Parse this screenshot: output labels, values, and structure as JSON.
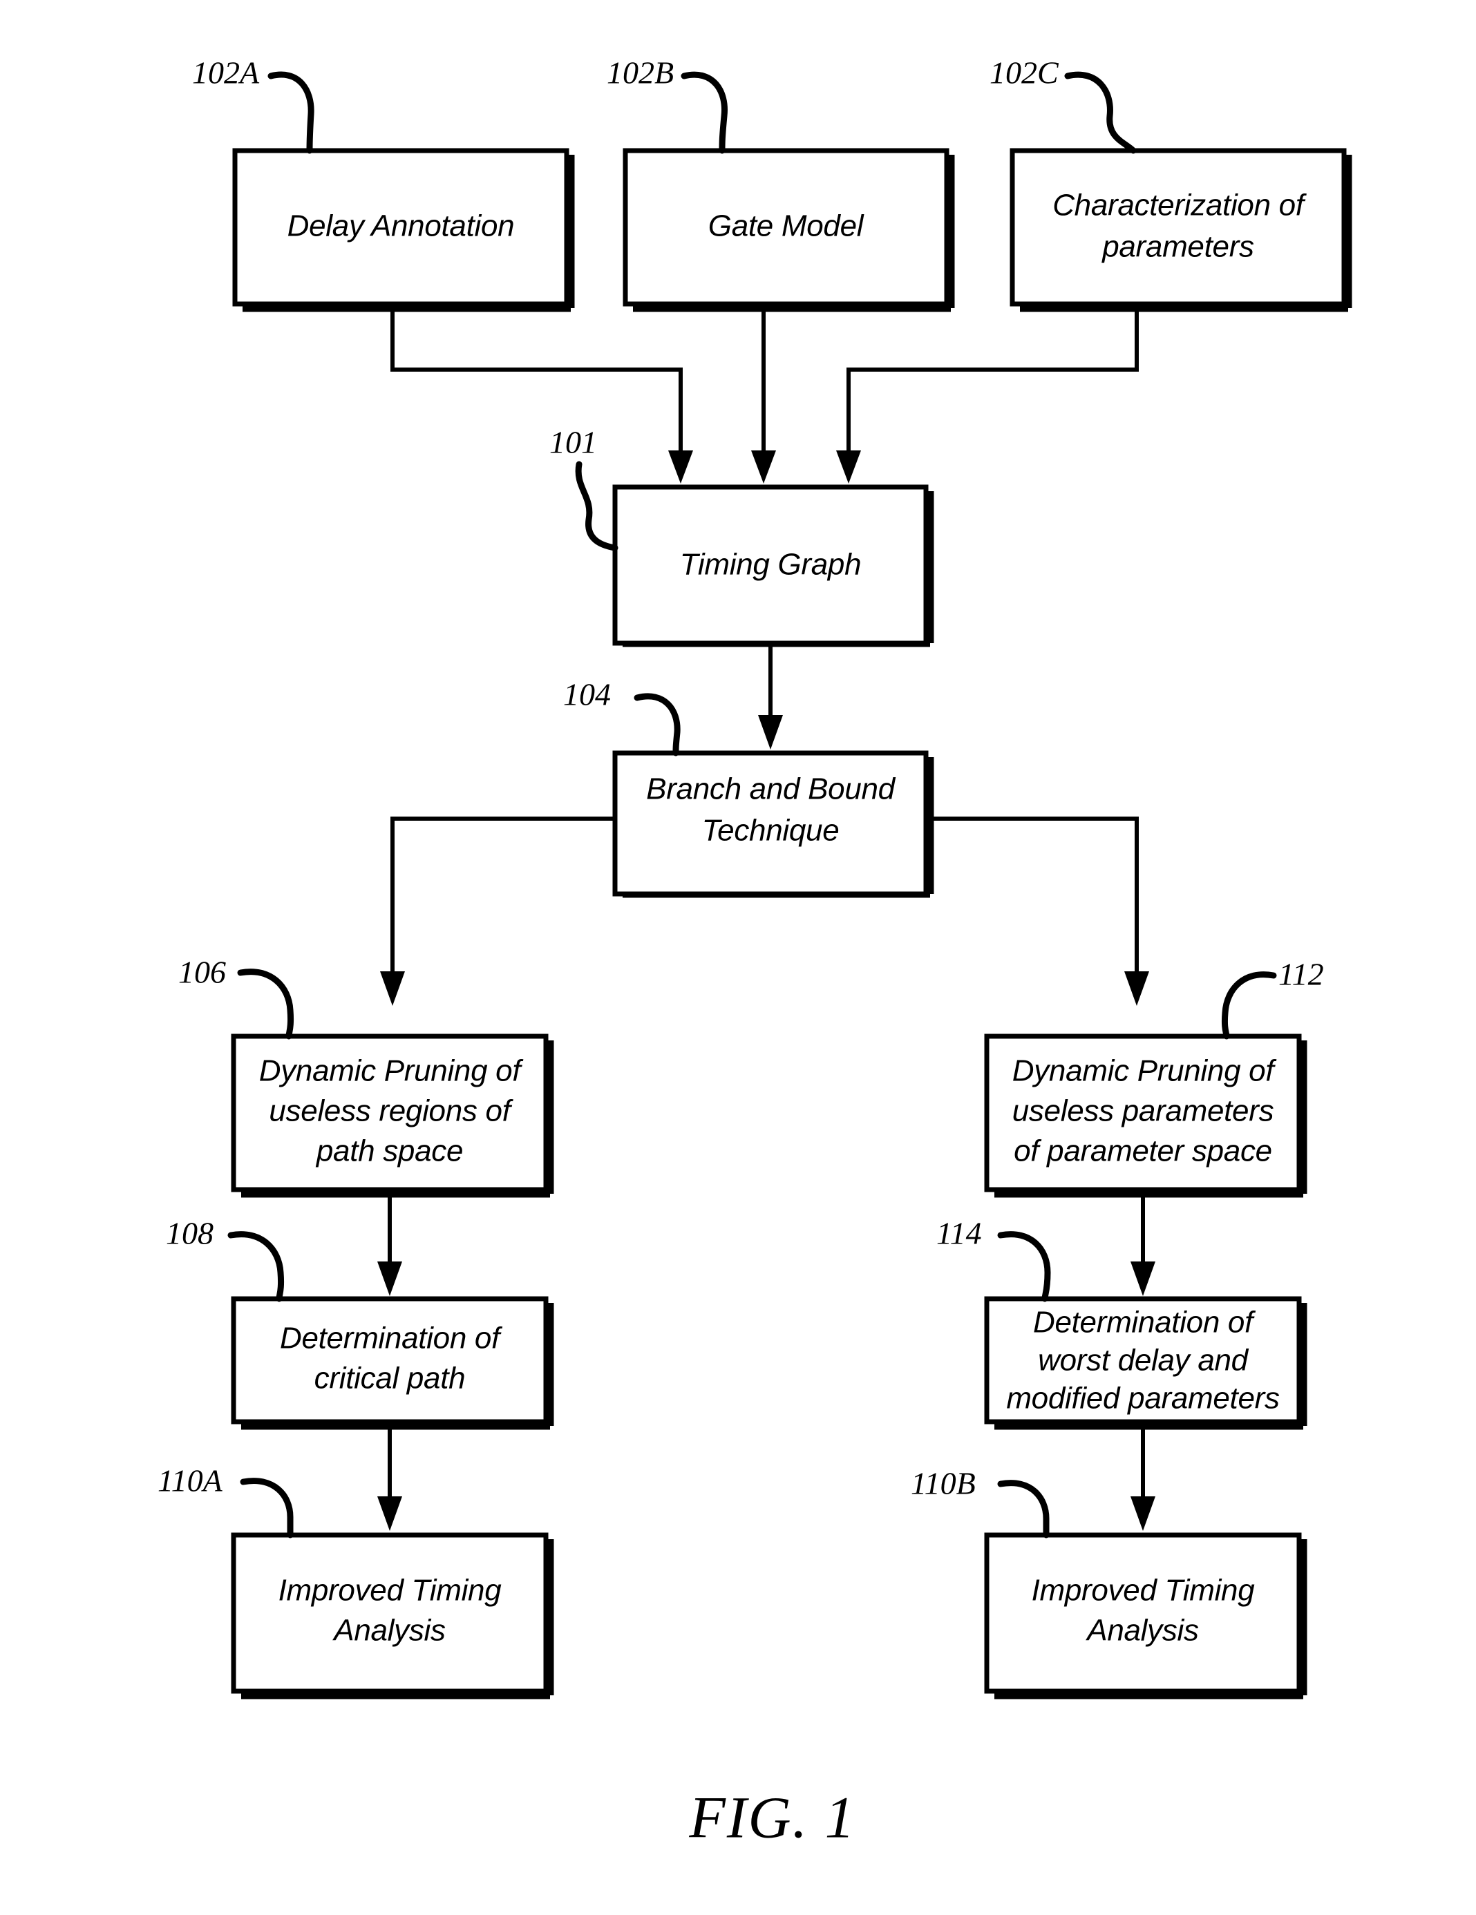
{
  "figure": {
    "caption": "FIG. 1",
    "background_color": "#ffffff",
    "line_color": "#000000"
  },
  "nodes": {
    "delay_annotation": {
      "ref": "102A",
      "lines": [
        "Delay Annotation"
      ]
    },
    "gate_model": {
      "ref": "102B",
      "lines": [
        "Gate Model"
      ]
    },
    "characterization": {
      "ref": "102C",
      "lines": [
        "Characterization of",
        "parameters"
      ]
    },
    "timing_graph": {
      "ref": "101",
      "lines": [
        "Timing Graph"
      ]
    },
    "branch_and_bound": {
      "ref": "104",
      "lines": [
        "Branch and Bound",
        "Technique"
      ]
    },
    "dynamic_pruning_paths": {
      "ref": "106",
      "lines": [
        "Dynamic Pruning of",
        "useless regions of",
        "path space"
      ]
    },
    "determination_critical_path": {
      "ref": "108",
      "lines": [
        "Determination of",
        "critical path"
      ]
    },
    "improved_timing_left": {
      "ref": "110A",
      "lines": [
        "Improved Timing",
        "Analysis"
      ]
    },
    "dynamic_pruning_params": {
      "ref": "112",
      "lines": [
        "Dynamic Pruning of",
        "useless parameters",
        "of parameter space"
      ]
    },
    "determination_worst_delay": {
      "ref": "114",
      "lines": [
        "Determination of",
        "worst delay and",
        "modified parameters"
      ]
    },
    "improved_timing_right": {
      "ref": "110B",
      "lines": [
        "Improved Timing",
        "Analysis"
      ]
    }
  }
}
